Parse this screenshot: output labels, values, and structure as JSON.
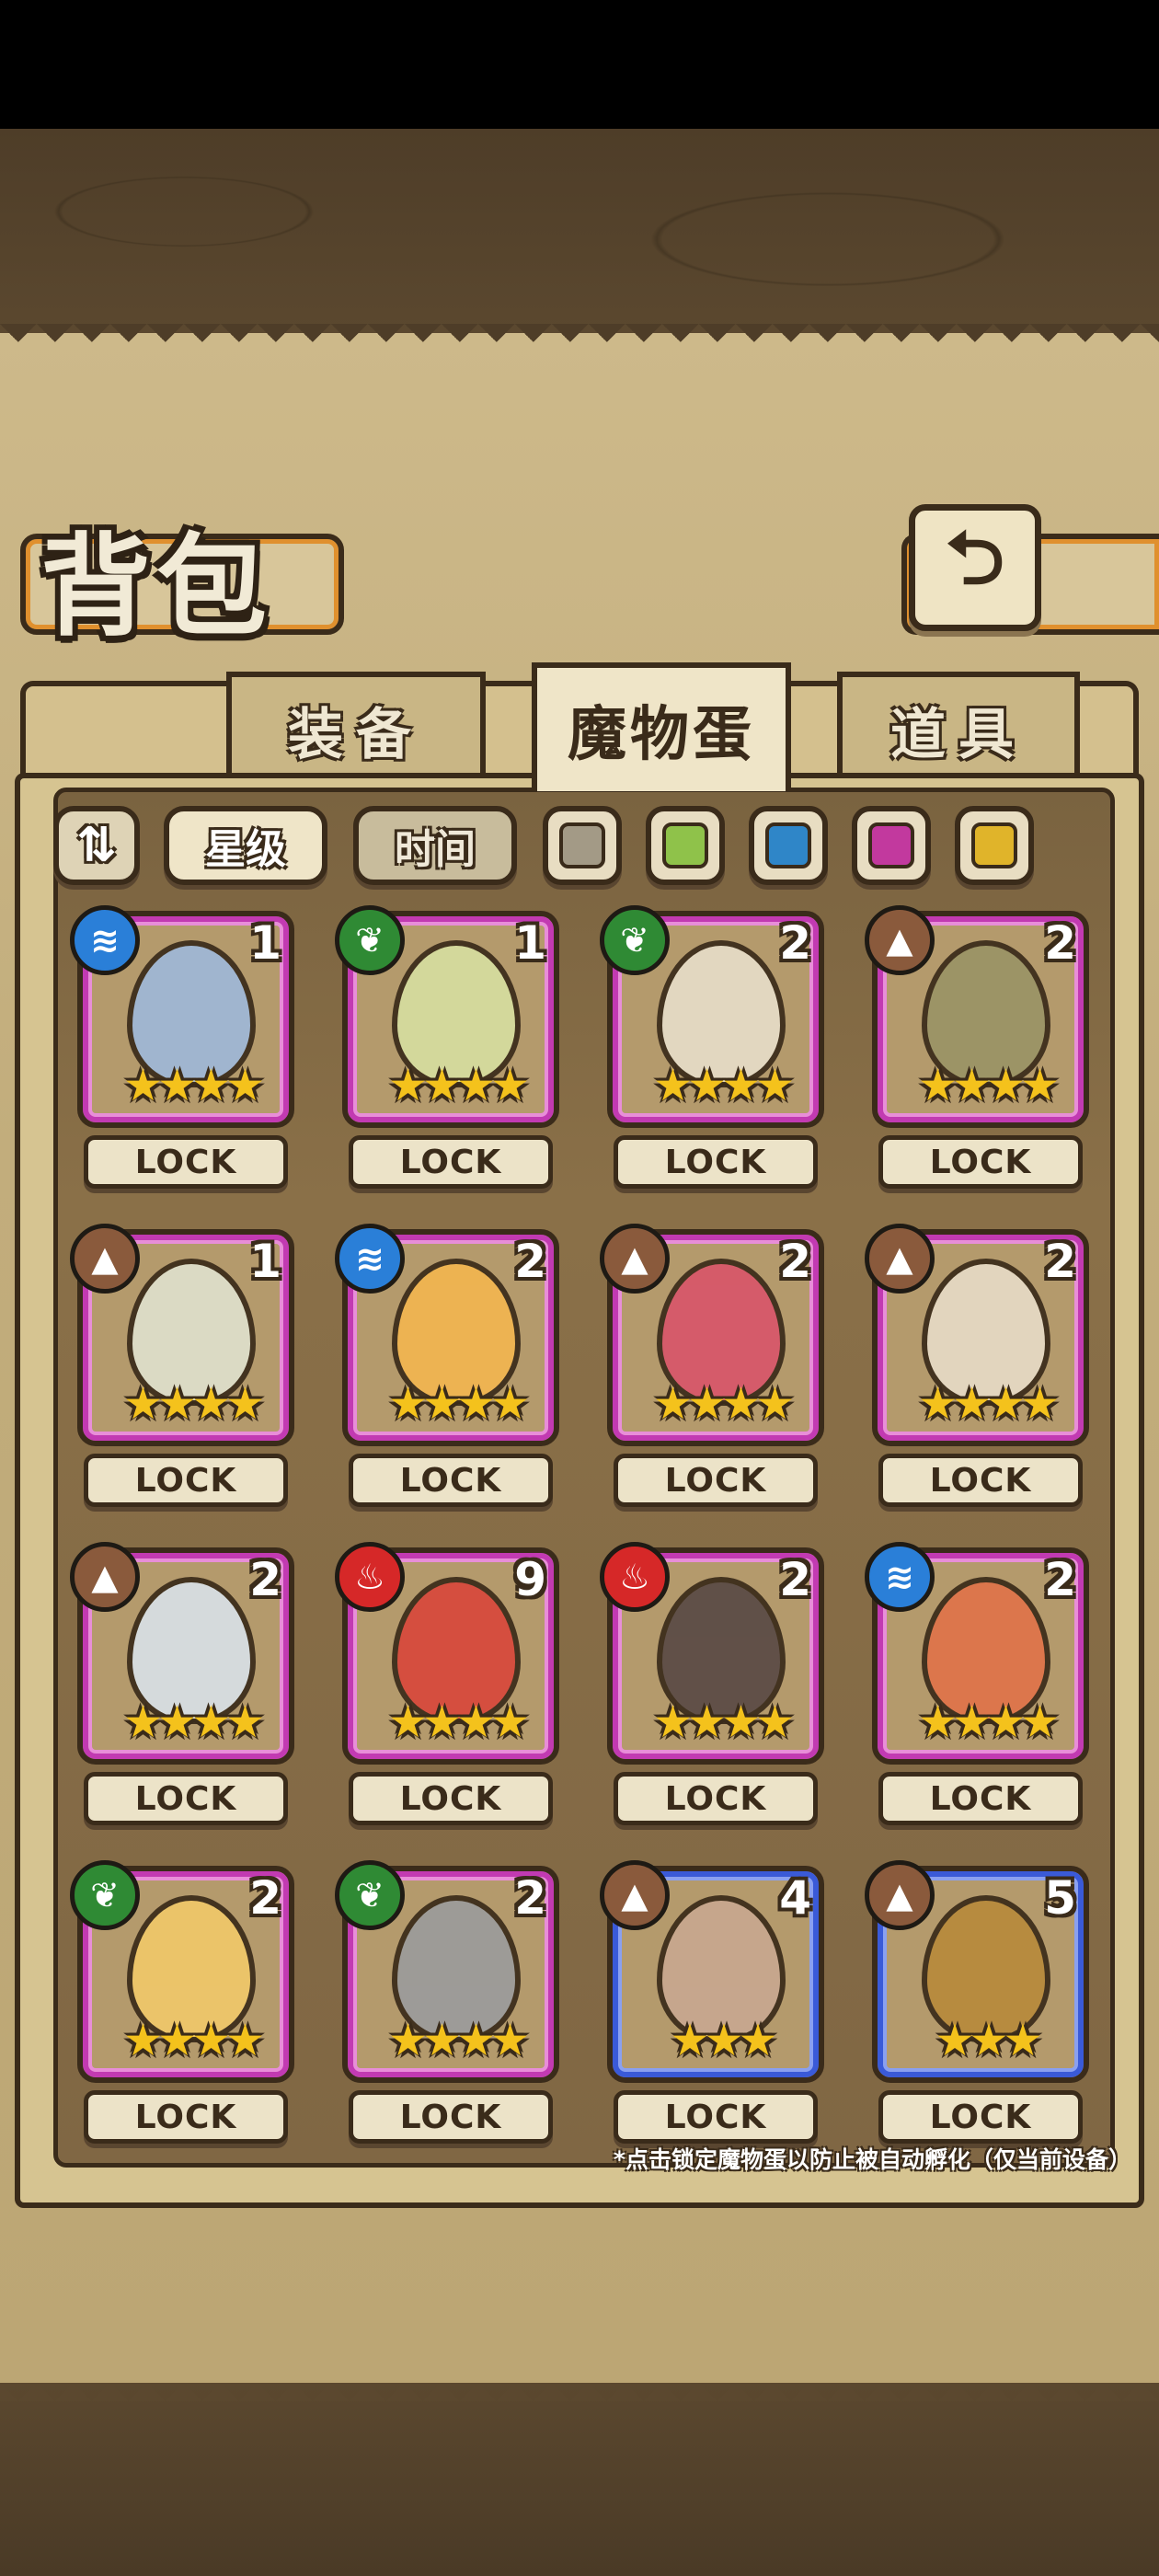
{
  "header": {
    "title": "背包",
    "back_icon": "return-arrow-icon"
  },
  "tabs": [
    {
      "label": "装备",
      "active": false
    },
    {
      "label": "魔物蛋",
      "active": true
    },
    {
      "label": "道具",
      "active": false
    }
  ],
  "filters": {
    "toggle_icon": "sort-toggle-icon",
    "star": "星级",
    "time": "时间",
    "colors": [
      "#a39a86",
      "#8fc24a",
      "#2f86c8",
      "#c2399e",
      "#e0b42a"
    ]
  },
  "lock_label": "LOCK",
  "eggs": [
    {
      "count": "1",
      "stars": "★★★★",
      "element": "water",
      "elem_color": "#2a7fd8",
      "egg_color": "#9fb8d8",
      "frame": "purple"
    },
    {
      "count": "1",
      "stars": "★★★★",
      "element": "grass",
      "elem_color": "#2f8a34",
      "egg_color": "#d6dea0",
      "frame": "purple"
    },
    {
      "count": "2",
      "stars": "★★★★",
      "element": "grass",
      "elem_color": "#2f8a34",
      "egg_color": "#e6ddc8",
      "frame": "purple"
    },
    {
      "count": "2",
      "stars": "★★★★",
      "element": "earth",
      "elem_color": "#8a5a3c",
      "egg_color": "#9a9466",
      "frame": "purple"
    },
    {
      "count": "1",
      "stars": "★★★★",
      "element": "earth",
      "elem_color": "#8a5a3c",
      "egg_color": "#dfe0cc",
      "frame": "purple"
    },
    {
      "count": "2",
      "stars": "★★★★",
      "element": "water",
      "elem_color": "#2a7fd8",
      "egg_color": "#f2b650",
      "frame": "purple"
    },
    {
      "count": "2",
      "stars": "★★★★",
      "element": "earth",
      "elem_color": "#8a5a3c",
      "egg_color": "#d8566a",
      "frame": "purple"
    },
    {
      "count": "2",
      "stars": "★★★★",
      "element": "earth",
      "elem_color": "#8a5a3c",
      "egg_color": "#e6dbc6",
      "frame": "purple"
    },
    {
      "count": "2",
      "stars": "★★★★",
      "element": "earth",
      "elem_color": "#8a5a3c",
      "egg_color": "#d8e0e6",
      "frame": "purple"
    },
    {
      "count": "9",
      "stars": "★★★★",
      "element": "fire",
      "elem_color": "#d62828",
      "egg_color": "#d8483c",
      "frame": "purple"
    },
    {
      "count": "2",
      "stars": "★★★★",
      "element": "fire",
      "elem_color": "#d62828",
      "egg_color": "#5a4a46",
      "frame": "purple"
    },
    {
      "count": "2",
      "stars": "★★★★",
      "element": "water",
      "elem_color": "#2a7fd8",
      "egg_color": "#e0744a",
      "frame": "purple"
    },
    {
      "count": "2",
      "stars": "★★★★",
      "element": "grass",
      "elem_color": "#2f8a34",
      "egg_color": "#f0c86a",
      "frame": "purple"
    },
    {
      "count": "2",
      "stars": "★★★★",
      "element": "grass",
      "elem_color": "#2f8a34",
      "egg_color": "#9c9c9c",
      "frame": "purple"
    },
    {
      "count": "4",
      "stars": "★★★",
      "element": "earth",
      "elem_color": "#8a5a3c",
      "egg_color": "#c8a890",
      "frame": "blue"
    },
    {
      "count": "5",
      "stars": "★★★",
      "element": "earth",
      "elem_color": "#8a5a3c",
      "egg_color": "#b88a3c",
      "frame": "blue"
    }
  ],
  "footnote": "*点击锁定魔物蛋以防止被自动孵化（仅当前设备）"
}
